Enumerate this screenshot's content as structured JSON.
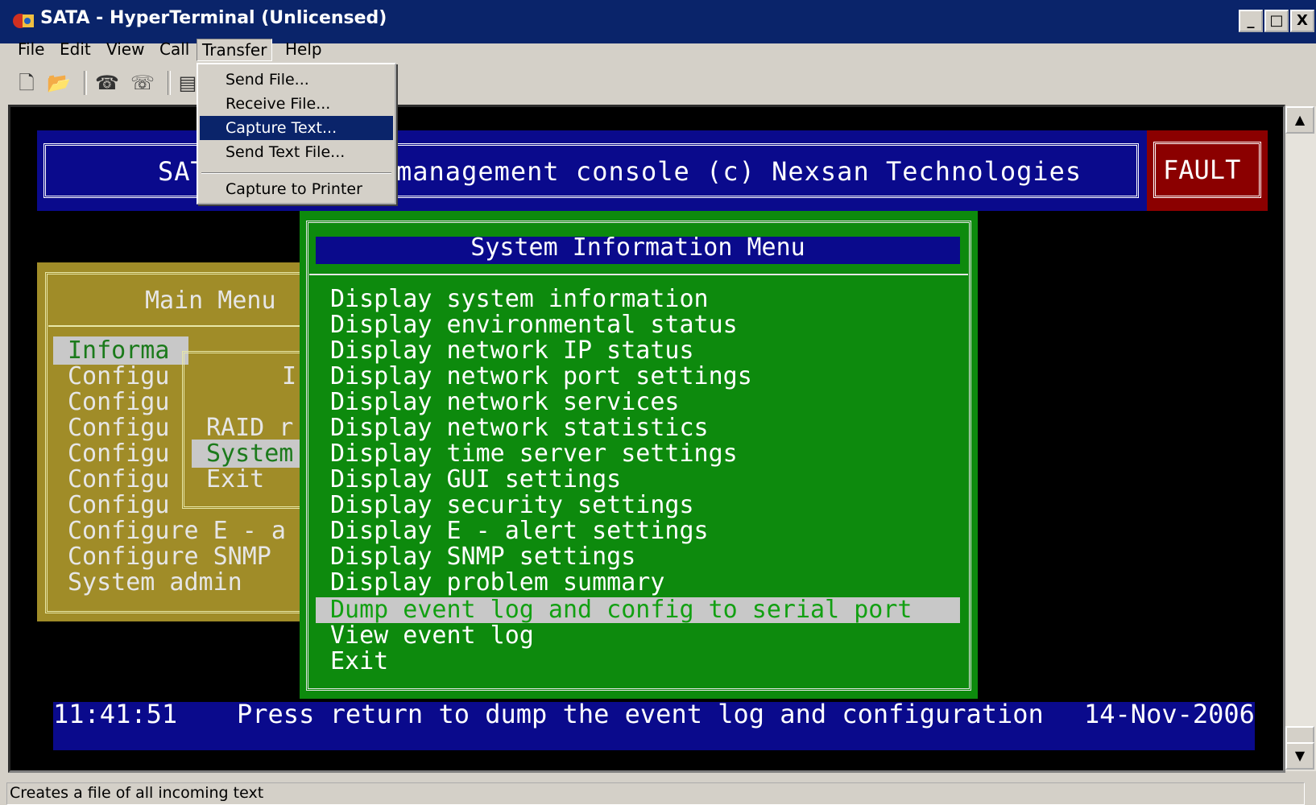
{
  "window": {
    "title": "SATA - HyperTerminal (Unlicensed)",
    "buttons": [
      "_",
      "□",
      "X"
    ]
  },
  "menubar": [
    "File",
    "Edit",
    "View",
    "Call",
    "Transfer",
    "Help"
  ],
  "toolbar_icons": [
    "new-icon",
    "open-icon",
    "disconnect-icon",
    "properties-icon",
    "send-icon"
  ],
  "transfer_menu": {
    "items": [
      "Send File...",
      "Receive File...",
      "Capture Text...",
      "Send Text File...",
      "Capture to Printer"
    ],
    "highlighted": "Capture Text..."
  },
  "terminal": {
    "header_text": "SAT",
    "header_text_tail": "management console (c) Nexsan Technologies",
    "fault_label": "FAULT",
    "main_menu": {
      "title": "Main Menu",
      "items": [
        "Informa",
        "Configu",
        "Configu",
        "Configu",
        "Configu",
        "Configu",
        "Configu",
        "Configure E - a",
        "Configure SNMP",
        "System admin"
      ]
    },
    "sub_menu": {
      "title_fragment": "I",
      "items": [
        "RAID r",
        "System",
        "Exit"
      ]
    },
    "system_info_menu": {
      "title": "System Information Menu",
      "items": [
        "Display system information",
        "Display environmental status",
        "Display network IP status",
        "Display network port settings",
        "Display network services",
        "Display network statistics",
        "Display time server settings",
        "Display GUI settings",
        "Display security settings",
        "Display E - alert settings",
        "Display SNMP settings",
        "Display problem summary",
        "Dump event log and config to serial port",
        "View event log",
        "Exit"
      ],
      "selected": "Dump event log and config to serial port"
    },
    "status_line": {
      "time": "11:41:51",
      "message": "Press return to dump the event log and configuration",
      "date": "14-Nov-2006"
    }
  },
  "statusbar": {
    "text": "Creates a file of all incoming text"
  },
  "colors": {
    "titlebar": "#0a246a",
    "terminal_bg": "#000000",
    "header_blue": "#0a0a8c",
    "fault_red": "#8b0000",
    "menu_green": "#0d8a0d",
    "main_menu_olive": "#a08c28"
  }
}
